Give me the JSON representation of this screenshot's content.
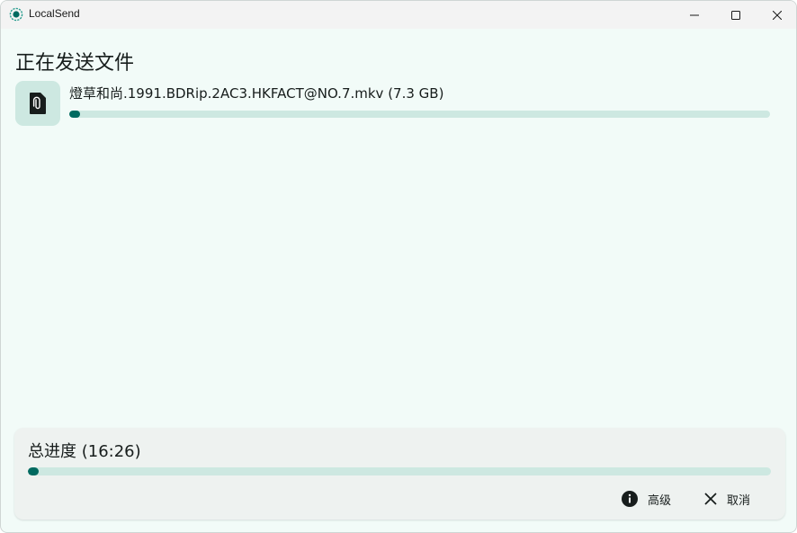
{
  "window": {
    "title": "LocalSend",
    "accent": "#006a60",
    "track_color": "#cde8e1",
    "background": "#f2fbf8"
  },
  "main": {
    "heading": "正在发送文件",
    "file": {
      "icon": "file-attachment-icon",
      "name": "燈草和尚.1991.BDRip.2AC3.HKFACT@NO.7.mkv (7.3 GB)",
      "progress": 0.015
    }
  },
  "footer": {
    "total_label": "总进度 (16:26)",
    "total_progress": 0.015,
    "advanced_label": "高级",
    "advanced_icon": "info-icon",
    "cancel_label": "取消",
    "cancel_icon": "close-icon"
  }
}
